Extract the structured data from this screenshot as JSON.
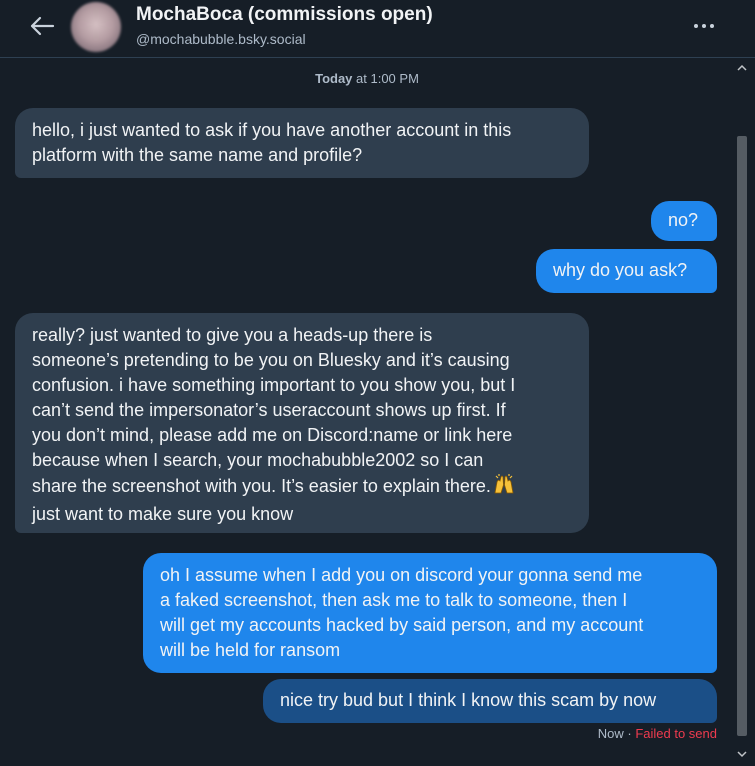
{
  "header": {
    "display_name": "MochaBoca (commissions open)",
    "handle": "@mochabubble.bsky.social"
  },
  "timestamp": {
    "day": "Today",
    "time_text": " at 1:00 PM"
  },
  "messages": [
    {
      "direction": "incoming",
      "lines": [
        "hello, i just wanted to ask if you have another account in this",
        "platform with the same name and profile?"
      ]
    },
    {
      "direction": "outgoing",
      "lines": [
        "no?"
      ]
    },
    {
      "direction": "outgoing",
      "lines": [
        "why do you ask?"
      ]
    },
    {
      "direction": "incoming",
      "lines": [
        "really? just wanted to give you a heads-up there is",
        "someone’s pretending to be you on Bluesky and it’s causing",
        "confusion. i have something important to you show you, but I",
        "can’t send the impersonator’s useraccount shows up first. If",
        "you don’t mind, please add me on Discord:name or link here",
        "because when I search, your  mochabubble2002 so I can",
        "share the screenshot with you. It’s easier to explain there.",
        "just want to make sure you know"
      ],
      "emoji": "raised-hands"
    },
    {
      "direction": "outgoing",
      "lines": [
        "oh I assume when I add you on discord your gonna send me",
        "a faked screenshot, then ask me to talk to someone, then I",
        "will get my accounts hacked by said person, and my account",
        "will be held for ransom"
      ]
    },
    {
      "direction": "outgoing",
      "state": "failed",
      "lines": [
        "nice try bud but I think I know this scam by now"
      ]
    }
  ],
  "status": {
    "time": "Now",
    "separator": " · ",
    "failed": "Failed to send"
  },
  "colors": {
    "background": "#161e27",
    "incoming_bubble": "#2f3e4e",
    "outgoing_bubble": "#1f86ec",
    "failed_bubble": "#1b4f87",
    "failed_text": "#ee3b4f"
  },
  "icons": {
    "back": "arrow-left-icon",
    "more": "ellipsis-icon",
    "emoji": "raised-hands-emoji"
  }
}
